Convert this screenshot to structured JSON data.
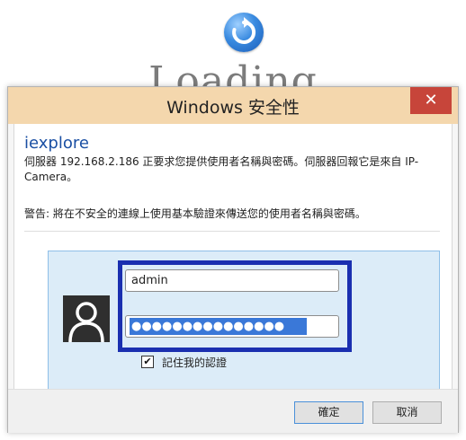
{
  "background": {
    "loading_text": "Loading"
  },
  "dialog": {
    "title": "Windows 安全性",
    "close_glyph": "✕",
    "app_name": "iexplore",
    "message": "伺服器 192.168.2.186 正要求您提供使用者名稱與密碼。伺服器回報它是來自 IP-Camera。",
    "warning": "警告: 將在不安全的連線上使用基本驗證來傳送您的使用者名稱與密碼。",
    "username_value": "admin",
    "password_mask": "●●●●●●●●●●●●●●●",
    "remember_checked_glyph": "✔",
    "remember_label": "記住我的認證",
    "ok_label": "確定",
    "cancel_label": "取消"
  },
  "icons": {
    "spinner": "refresh-icon",
    "avatar": "user-avatar-icon",
    "close": "close-icon"
  },
  "colors": {
    "titlebar": "#f4d7ad",
    "close_button": "#c7453a",
    "app_name": "#1a4fa3",
    "tile_bg": "#dcecf8",
    "highlight_border": "#1a2fb0",
    "password_selection": "#3a78d8"
  }
}
